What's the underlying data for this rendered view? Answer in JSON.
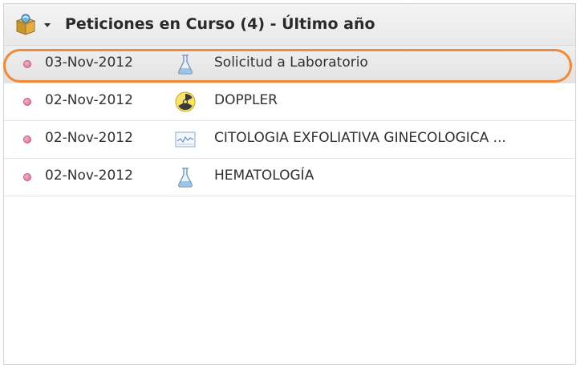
{
  "panel": {
    "title": "Peticiones en Curso (4) - Último año",
    "header_icon": "package-box-icon",
    "collapse_icon": "chevron-down-icon"
  },
  "colors": {
    "highlight_ring": "#ee8a3a",
    "status_dot": "#d66a8d",
    "selected_row": "#e9e9e9"
  },
  "rows": [
    {
      "date": "03-Nov-2012",
      "icon": "lab-flask-icon",
      "description": "Solicitud a Laboratorio",
      "selected": true
    },
    {
      "date": "02-Nov-2012",
      "icon": "radiation-icon",
      "description": "DOPPLER",
      "selected": false
    },
    {
      "date": "02-Nov-2012",
      "icon": "document-chart-icon",
      "description": "CITOLOGIA EXFOLIATIVA GINECOLOGICA ...",
      "selected": false
    },
    {
      "date": "02-Nov-2012",
      "icon": "lab-flask-icon",
      "description": "HEMATOLOGÍA",
      "selected": false
    }
  ]
}
